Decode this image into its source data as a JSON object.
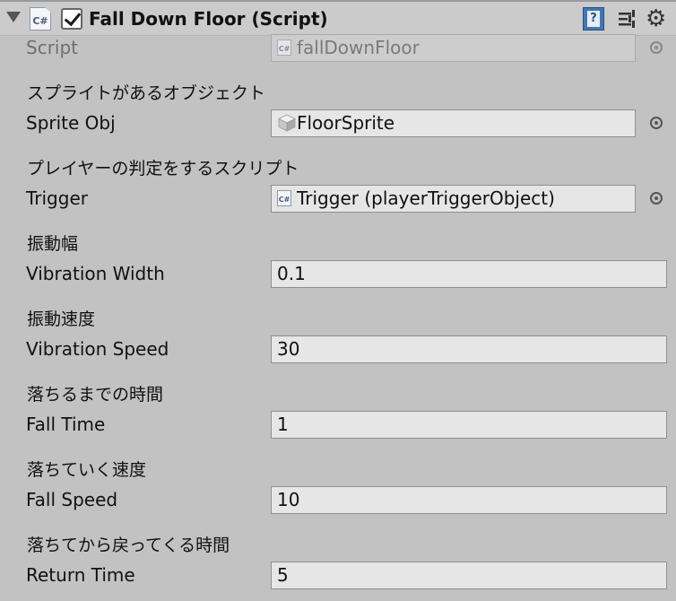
{
  "header": {
    "title": "Fall Down Floor (Script)",
    "enabled": true,
    "component_icon_label": "C#"
  },
  "script": {
    "label": "Script",
    "value": "fallDownFloor",
    "icon_label": "C#"
  },
  "sprite_obj": {
    "group_label": "スプライトがあるオブジェクト",
    "label": "Sprite Obj",
    "value": "FloorSprite"
  },
  "trigger": {
    "group_label": "プレイヤーの判定をするスクリプト",
    "label": "Trigger",
    "value": "Trigger (playerTriggerObject)",
    "icon_label": "C#"
  },
  "vibration_width": {
    "group_label": "振動幅",
    "label": "Vibration Width",
    "value": "0.1"
  },
  "vibration_speed": {
    "group_label": "振動速度",
    "label": "Vibration Speed",
    "value": "30"
  },
  "fall_time": {
    "group_label": "落ちるまでの時間",
    "label": "Fall Time",
    "value": "1"
  },
  "fall_speed": {
    "group_label": "落ちていく速度",
    "label": "Fall Speed",
    "value": "10"
  },
  "return_time": {
    "group_label": "落ちてから戻ってくる時間",
    "label": "Return Time",
    "value": "5"
  },
  "colors": {
    "background": "#c2c2c2",
    "field_background": "#e6e6e6",
    "help_icon": "#3f78b5"
  }
}
